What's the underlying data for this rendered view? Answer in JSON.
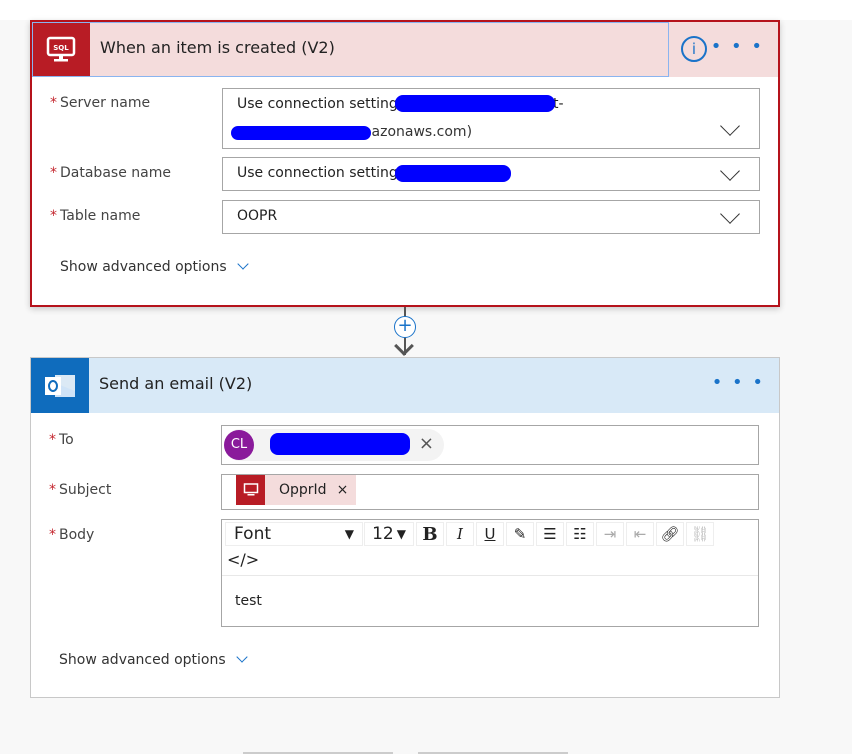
{
  "trigger": {
    "title": "When an item is created (V2)",
    "icon": "sql-icon",
    "info_icon": "info-icon",
    "more_icon": "more-dots-icon",
    "fields": [
      {
        "label": "Server name",
        "value_line1": "Use connection settings",
        "value_line1_tail": "t-",
        "value_line2": "pute.amazonaws.com)"
      },
      {
        "label": "Database name",
        "value": "Use connection settings"
      },
      {
        "label": "Table name",
        "value": "OOPR"
      }
    ],
    "show_advanced": "Show advanced options"
  },
  "action": {
    "title": "Send an email (V2)",
    "icon": "outlook-icon",
    "more_icon": "more-dots-icon",
    "to_label": "To",
    "to_avatar": "CL",
    "subject_label": "Subject",
    "subject_token": "OpprId",
    "body_label": "Body",
    "toolbar": {
      "font": "Font",
      "size": "12"
    },
    "body_text": "test",
    "show_advanced": "Show advanced options"
  },
  "colors": {
    "trigger_accent": "#b81c25",
    "action_accent": "#0f6cbd",
    "link": "#1a73c9"
  }
}
